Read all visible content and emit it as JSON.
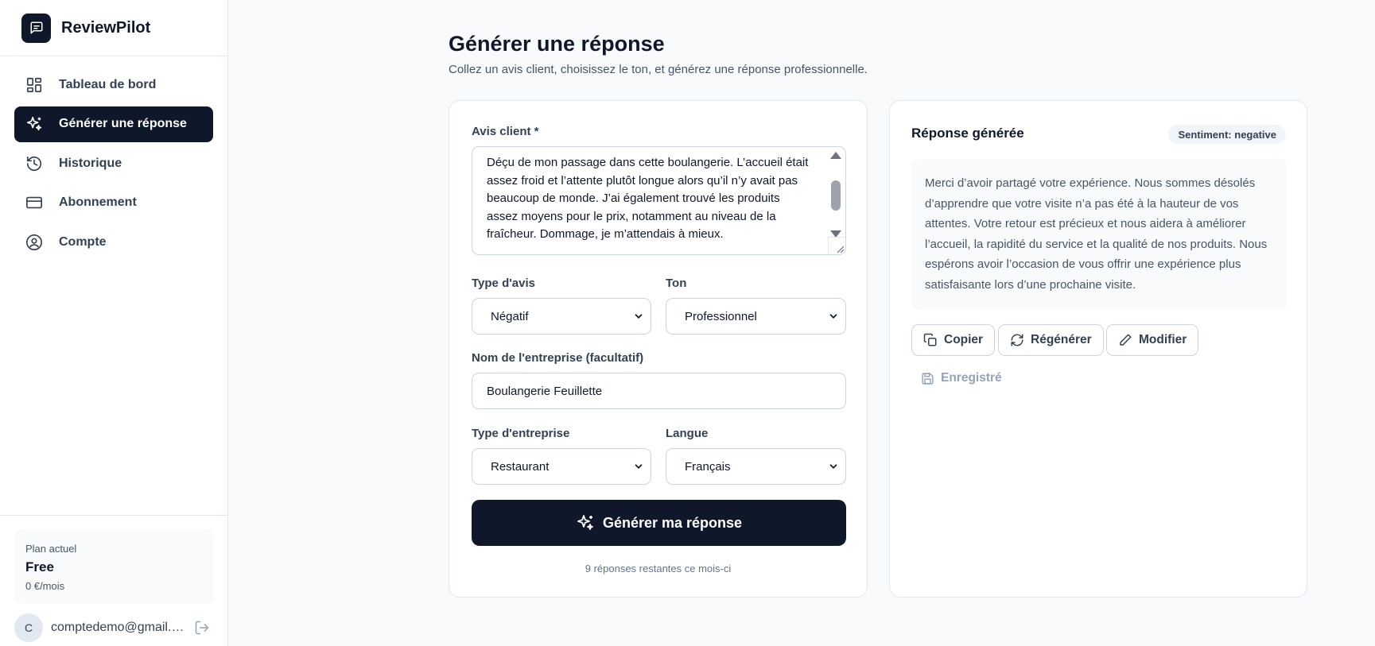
{
  "brand": {
    "name": "ReviewPilot"
  },
  "sidebar": {
    "items": [
      {
        "label": "Tableau de bord",
        "icon": "dashboard-icon"
      },
      {
        "label": "Générer une réponse",
        "icon": "sparkles-icon",
        "active": true
      },
      {
        "label": "Historique",
        "icon": "history-icon"
      },
      {
        "label": "Abonnement",
        "icon": "credit-card-icon"
      },
      {
        "label": "Compte",
        "icon": "user-circle-icon"
      }
    ],
    "plan": {
      "label": "Plan actuel",
      "name": "Free",
      "price": "0 €/mois"
    },
    "user": {
      "initial": "C",
      "email": "comptedemo@gmail.com"
    }
  },
  "page": {
    "title": "Générer une réponse",
    "subtitle": "Collez un avis client, choisissez le ton, et générez une réponse professionnelle."
  },
  "form": {
    "review_label": "Avis client *",
    "review_text": "Déçu de mon passage dans cette boulangerie. L’accueil était assez froid et l’attente plutôt longue alors qu’il n’y avait pas beaucoup de monde. J’ai également trouvé les produits assez moyens pour le prix, notamment au niveau de la fraîcheur. Dommage, je m’attendais à mieux.",
    "review_type_label": "Type d'avis",
    "review_type_value": "Négatif",
    "tone_label": "Ton",
    "tone_value": "Professionnel",
    "company_label": "Nom de l'entreprise (facultatif)",
    "company_value": "Boulangerie Feuillette",
    "business_type_label": "Type d'entreprise",
    "business_type_value": "Restaurant",
    "language_label": "Langue",
    "language_value": "Français",
    "generate_label": "Générer ma réponse",
    "remaining": "9 réponses restantes ce mois-ci"
  },
  "response": {
    "title": "Réponse générée",
    "sentiment": "Sentiment: negative",
    "text": "Merci d’avoir partagé votre expérience. Nous sommes désolés d’apprendre que votre visite n’a pas été à la hauteur de vos attentes. Votre retour est précieux et nous aidera à améliorer l’accueil, la rapidité du service et la qualité de nos produits. Nous espérons avoir l’occasion de vous offrir une expérience plus satisfaisante lors d’une prochaine visite.",
    "copy_label": "Copier",
    "regenerate_label": "Régénérer",
    "edit_label": "Modifier",
    "saved_label": "Enregistré"
  },
  "colors": {
    "primary": "#0f172a",
    "muted": "#475569",
    "border": "#cbd5e1"
  }
}
